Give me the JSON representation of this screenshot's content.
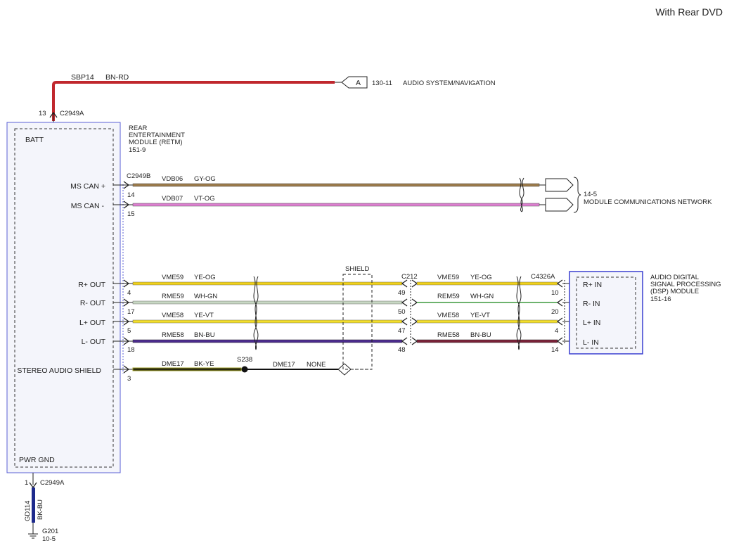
{
  "header": {
    "title": "With Rear DVD"
  },
  "colors": {
    "bn_rd": "#c0272d",
    "gy_og": "#9b7a4a",
    "vt_og": "#dd7fd0",
    "ye_og": "#f1d21a",
    "wh_gn": "#c8d8c4",
    "ye_vt": "#f4df2a",
    "bn_bu": "#4b2b8e",
    "bn_bu_right": "#7a2138",
    "bk_ye": "#2a2a10",
    "wh_gn_right": "#3e9a3e",
    "gd114": "#1e2a8c",
    "module_frame": "#3a3fd0"
  },
  "power": {
    "circuit": "SBP14",
    "color": "BN-RD",
    "connector_letter": "A",
    "ref": "130-11",
    "dest": "AUDIO SYSTEM/NAVIGATION",
    "pin": "13",
    "connector": "C2949A"
  },
  "retm": {
    "name_line1": "REAR",
    "name_line2": "ENTERTAINMENT",
    "name_line3": "MODULE (RETM)",
    "ref": "151-9",
    "batt": "BATT",
    "pwr_gnd": "PWR GND",
    "connector_b": "C2949B"
  },
  "can": {
    "ref": "14-5",
    "dest": "MODULE COMMUNICATIONS NETWORK",
    "lines": [
      {
        "label": "MS CAN +",
        "pin": "14",
        "circuit": "VDB06",
        "color": "GY-OG"
      },
      {
        "label": "MS CAN -",
        "pin": "15",
        "circuit": "VDB07",
        "color": "VT-OG"
      }
    ]
  },
  "shield_label": "SHIELD",
  "c212": "C212",
  "c4326a": "C4326A",
  "audio": [
    {
      "label": "R+ OUT",
      "pin": "4",
      "circuit": "VME59",
      "color": "YE-OG",
      "c212_pin": "49",
      "r_circuit": "VME59",
      "r_color": "YE-OG",
      "dsp_pin": "10",
      "dsp_label": "R+ IN"
    },
    {
      "label": "R- OUT",
      "pin": "17",
      "circuit": "RME59",
      "color": "WH-GN",
      "c212_pin": "50",
      "r_circuit": "REM59",
      "r_color": "WH-GN",
      "dsp_pin": "20",
      "dsp_label": "R- IN"
    },
    {
      "label": "L+ OUT",
      "pin": "5",
      "circuit": "VME58",
      "color": "YE-VT",
      "c212_pin": "47",
      "r_circuit": "VME58",
      "r_color": "YE-VT",
      "dsp_pin": "4",
      "dsp_label": "L+ IN"
    },
    {
      "label": "L- OUT",
      "pin": "18",
      "circuit": "RME58",
      "color": "BN-BU",
      "c212_pin": "48",
      "r_circuit": "RME58",
      "r_color": "BN-BU",
      "dsp_pin": "14",
      "dsp_label": "L- IN"
    }
  ],
  "stereo_shield": {
    "label": "STEREO AUDIO SHIELD",
    "pin": "3",
    "circuit": "DME17",
    "color": "BK-YE",
    "splice": "S238",
    "circuit2": "DME17",
    "color2": "NONE"
  },
  "dsp": {
    "name_line1": "AUDIO DIGITAL",
    "name_line2": "SIGNAL PROCESSING",
    "name_line3": "(DSP) MODULE",
    "ref": "151-16"
  },
  "ground": {
    "pin": "1",
    "connector": "C2949A",
    "circuit": "GD114",
    "color": "BK-BU",
    "point": "G201",
    "ref": "10-5"
  }
}
